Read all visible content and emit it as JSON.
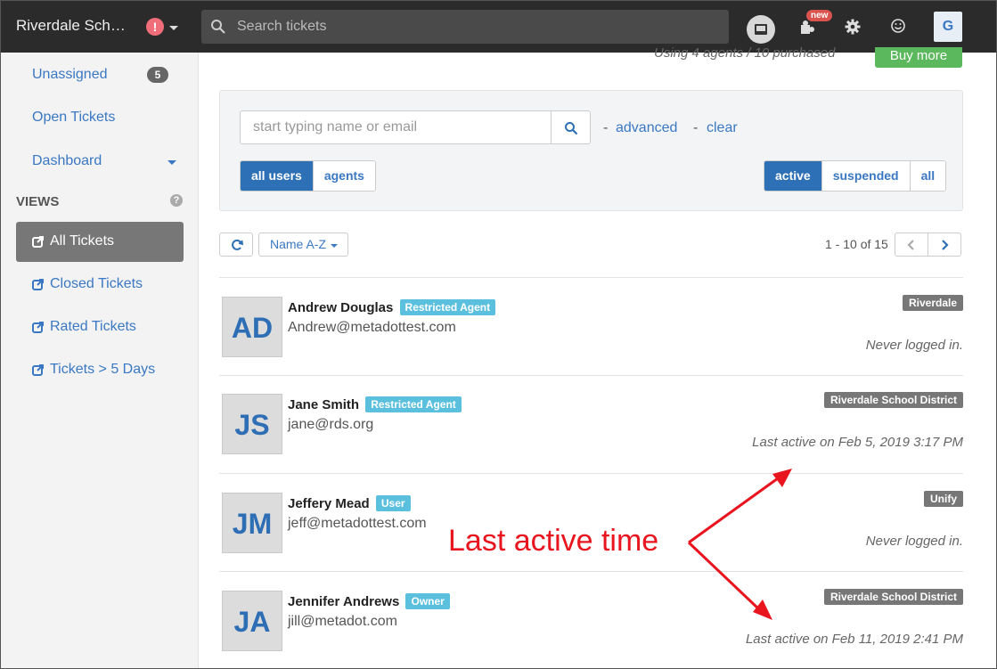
{
  "topbar": {
    "brand": "Riverdale Sch…",
    "alert_glyph": "!",
    "search_placeholder": "Search tickets",
    "new_badge": "new",
    "user_initial": "G",
    "icons": [
      "search-icon",
      "book-icon",
      "puzzle-icon",
      "gear-icon",
      "smile-icon"
    ]
  },
  "sidebar": {
    "unassigned": "Unassigned",
    "unassigned_count": "5",
    "open_tickets": "Open Tickets",
    "dashboard": "Dashboard",
    "views_heading": "VIEWS",
    "help_glyph": "?",
    "views": [
      {
        "label": "All Tickets",
        "active": true
      },
      {
        "label": "Closed Tickets",
        "active": false
      },
      {
        "label": "Rated Tickets",
        "active": false
      },
      {
        "label": "Tickets > 5 Days",
        "active": false
      }
    ]
  },
  "header": {
    "using_text": "Using 4 agents / 10 purchased",
    "buy_more": "Buy more"
  },
  "filter": {
    "name_placeholder": "start typing name or email",
    "advanced": "advanced",
    "clear": "clear",
    "dash": "-",
    "user_types": [
      "all users",
      "agents"
    ],
    "status": [
      "active",
      "suspended",
      "all"
    ]
  },
  "toolbar": {
    "sort_label": "Name A-Z",
    "pagination": "1 - 10 of 15"
  },
  "users": [
    {
      "initials": "AD",
      "name": "Andrew Douglas",
      "role": "Restricted Agent",
      "email": "Andrew@metadottest.com",
      "org": "Riverdale",
      "last_active": "Never logged in."
    },
    {
      "initials": "JS",
      "name": "Jane Smith",
      "role": "Restricted Agent",
      "email": "jane@rds.org",
      "org": "Riverdale School District",
      "last_active": "Last active on Feb 5, 2019 3:17 PM"
    },
    {
      "initials": "JM",
      "name": "Jeffery Mead",
      "role": "User",
      "email": "jeff@metadottest.com",
      "org": "Unify",
      "last_active": "Never logged in."
    },
    {
      "initials": "JA",
      "name": "Jennifer Andrews",
      "role": "Owner",
      "email": "jill@metadot.com",
      "org": "Riverdale School District",
      "last_active": "Last active on Feb 11, 2019 2:41 PM"
    }
  ],
  "annotation": {
    "text": "Last active time",
    "color": "#e8141e"
  }
}
